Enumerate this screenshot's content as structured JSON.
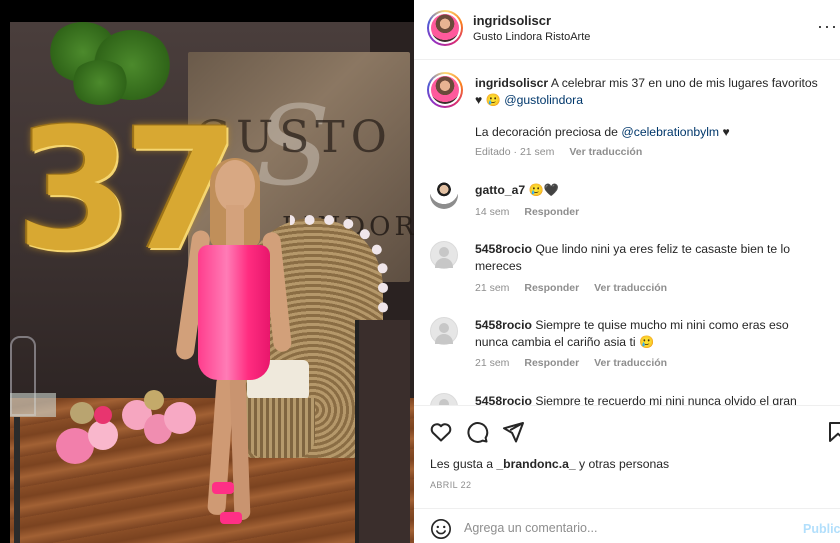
{
  "post": {
    "author": "ingridsoliscr",
    "location": "Gusto Lindora RistoArte",
    "balloon_number": "37",
    "sign_text": "GUSTO",
    "sign_sub": "LINDORA"
  },
  "caption": {
    "user": "ingridsoliscr",
    "text_part1": "A celebrar mis 37 en uno de mis lugares favoritos ♥ 🥲",
    "mention1": "@gustolindora",
    "text_part2": "La decoración preciosa de",
    "mention2": "@celebrationbylm",
    "heart": "♥",
    "meta_edited": "Editado · 21 sem",
    "meta_translate": "Ver traducción"
  },
  "comments": [
    {
      "user": "gatto_a7",
      "text": "🥲🖤",
      "time": "14 sem",
      "reply": "Responder",
      "translate": ""
    },
    {
      "user": "5458rocio",
      "text": "Que lindo nini ya eres feliz te casaste bien te lo mereces",
      "time": "21 sem",
      "reply": "Responder",
      "translate": "Ver traducción"
    },
    {
      "user": "5458rocio",
      "text": "Siempre te quise mucho mi nini como eras eso nunca cambia el cariño asia ti 🥲",
      "time": "21 sem",
      "reply": "Responder",
      "translate": "Ver traducción"
    },
    {
      "user": "5458rocio",
      "text": "Siempre te recuerdo mi nini nunca olvido el gran",
      "time": "",
      "reply": "",
      "translate": ""
    }
  ],
  "likes": {
    "prefix": "Les gusta a",
    "user": "_brandonc.a_",
    "suffix": "y otras personas"
  },
  "date": "ABRIL 22",
  "add_comment": {
    "placeholder": "Agrega un comentario...",
    "publish": "Publicar"
  },
  "icons": [
    "heart-icon",
    "comment-icon",
    "share-icon",
    "bookmark-icon",
    "emoji-icon",
    "more-icon"
  ]
}
